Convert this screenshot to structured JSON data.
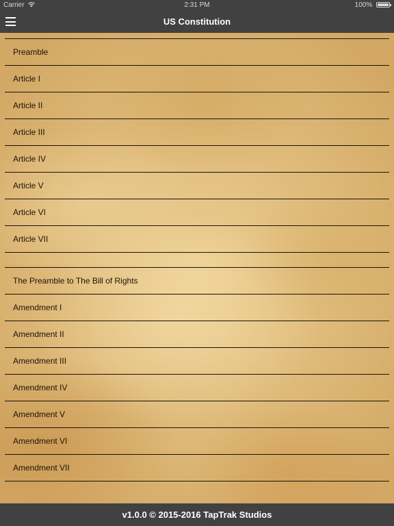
{
  "status_bar": {
    "carrier": "Carrier",
    "time": "2:31 PM",
    "battery": "100%"
  },
  "nav": {
    "title": "US Constitution",
    "menu_icon": "hamburger-menu-icon"
  },
  "list": {
    "items": [
      {
        "label": "Preamble"
      },
      {
        "label": "Article I"
      },
      {
        "label": "Article II"
      },
      {
        "label": "Article III"
      },
      {
        "label": "Article IV"
      },
      {
        "label": "Article V"
      },
      {
        "label": "Article VI"
      },
      {
        "label": "Article VII"
      },
      {
        "label": ""
      },
      {
        "label": "The Preamble to The Bill of Rights"
      },
      {
        "label": "Amendment I"
      },
      {
        "label": "Amendment II"
      },
      {
        "label": "Amendment III"
      },
      {
        "label": "Amendment IV"
      },
      {
        "label": "Amendment V"
      },
      {
        "label": "Amendment VI"
      },
      {
        "label": "Amendment VII"
      }
    ]
  },
  "footer": {
    "text": "v1.0.0 © 2015-2016 TapTrak Studios"
  },
  "colors": {
    "bar_background": "#414141",
    "parchment": "#eccf92",
    "row_divider": "#1a1208",
    "row_text": "#1c1408"
  }
}
